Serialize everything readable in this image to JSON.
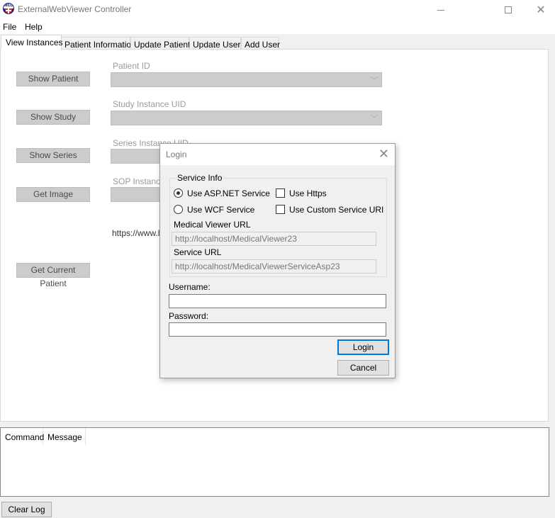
{
  "window": {
    "title": "ExternalWebViewer Controller",
    "icon": "med-app-icon",
    "controls": {
      "minimize": "minimize-icon",
      "maximize": "maximize-icon",
      "close": "close-icon"
    }
  },
  "menu": {
    "items": [
      "File",
      "Help"
    ]
  },
  "tabs": [
    {
      "label": "View Instances",
      "active": true
    },
    {
      "label": "Patient Information",
      "active": false
    },
    {
      "label": "Update Patient",
      "active": false
    },
    {
      "label": "Update User",
      "active": false
    },
    {
      "label": "Add User",
      "active": false
    }
  ],
  "view_instances": {
    "buttons": {
      "show_patient": "Show Patient",
      "show_study": "Show Study",
      "show_series": "Show Series",
      "get_image": "Get Image",
      "get_current_patient": "Get Current Patient"
    },
    "fields": {
      "patient_id": {
        "label": "Patient ID",
        "value": ""
      },
      "study_uid": {
        "label": "Study Instance UID",
        "value": ""
      },
      "series_uid": {
        "label": "Series Instance UID",
        "value": ""
      },
      "sop_uid": {
        "label": "SOP Instance UID",
        "value": ""
      }
    },
    "url_text": "https://www.le"
  },
  "log": {
    "columns": [
      "Command",
      "Message"
    ],
    "rows": [],
    "clear_label": "Clear Log"
  },
  "login_dialog": {
    "title": "Login",
    "service_info": {
      "legend": "Service Info",
      "use_aspnet": {
        "label": "Use ASP.NET Service",
        "checked": true
      },
      "use_wcf": {
        "label": "Use WCF Service",
        "checked": false
      },
      "use_https": {
        "label": "Use Https",
        "checked": false
      },
      "use_custom_uri": {
        "label": "Use Custom Service URI",
        "checked": false
      },
      "viewer_url_label": "Medical Viewer URL",
      "viewer_url_value": "http://localhost/MedicalViewer23",
      "service_url_label": "Service URL",
      "service_url_value": "http://localhost/MedicalViewerServiceAsp23"
    },
    "username_label": "Username:",
    "username_value": "",
    "password_label": "Password:",
    "password_value": "",
    "login_label": "Login",
    "cancel_label": "Cancel"
  }
}
